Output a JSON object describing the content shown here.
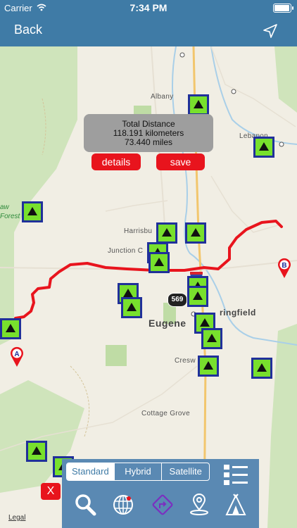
{
  "status": {
    "carrier": "Carrier",
    "time": "7:34 PM",
    "battery_level": 0.9
  },
  "nav": {
    "back_label": "Back"
  },
  "info": {
    "title": "Total Distance",
    "km": "118.191 kilometers",
    "miles": "73.440 miles",
    "details_label": "details",
    "save_label": "save"
  },
  "map": {
    "towns": {
      "albany": "Albany",
      "lebanon": "Lebanon",
      "harrisburg": "Harrisbu",
      "junction_city": "Junction C",
      "eugene": "Eugene",
      "springfield": "ringfield",
      "creswell": "Cresw",
      "cottage_grove": "Cottage Grove",
      "forest_top": "aw",
      "forest_bottom": "Forest"
    },
    "route_shield": "569",
    "marker_a": "A",
    "marker_b": "B"
  },
  "toolbar": {
    "segments": [
      "Standard",
      "Hybrid",
      "Satellite"
    ],
    "selected": "Standard"
  },
  "close_label": "X",
  "legal_label": "Legal",
  "colors": {
    "bar": "#3f7ba6",
    "route": "#e8141d",
    "camp_bg": "#20309a",
    "camp_fill": "#78e02d"
  }
}
